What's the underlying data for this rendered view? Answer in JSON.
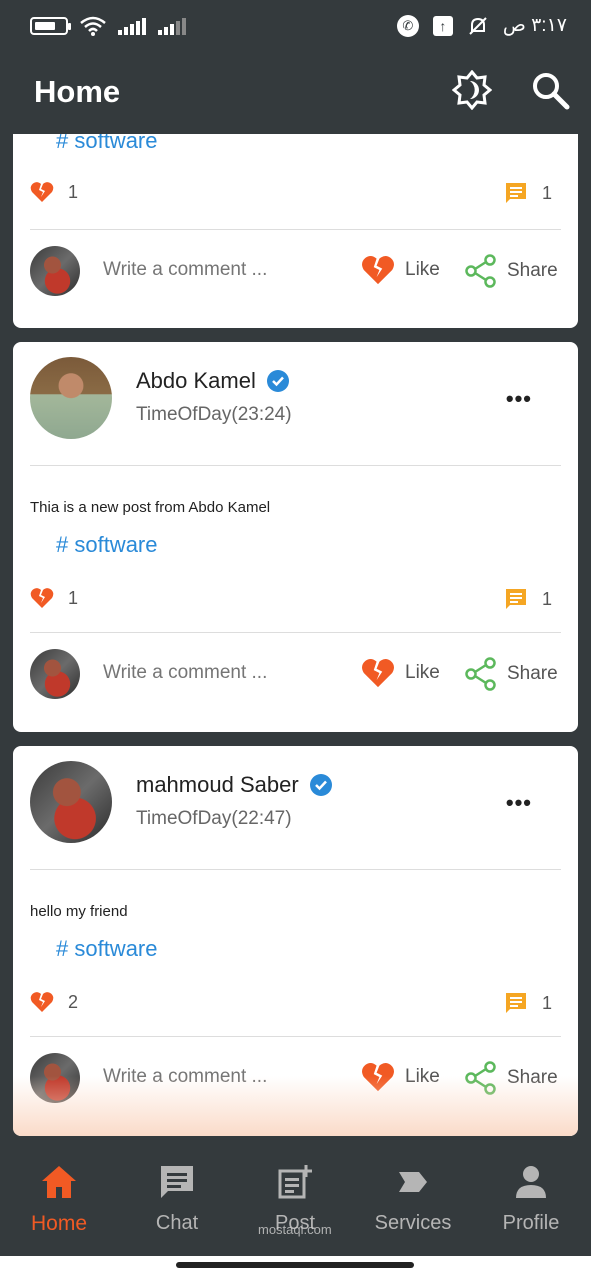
{
  "status_bar": {
    "time": "٣:١٧ ص",
    "icons": [
      "battery-icon",
      "wifi-icon",
      "signal-icon",
      "signal-icon",
      "phone-icon",
      "upload-icon",
      "mute-bell-icon"
    ]
  },
  "app_bar": {
    "title": "Home",
    "icons": [
      "brightness-icon",
      "search-icon"
    ]
  },
  "posts": [
    {
      "hashtag": "# software",
      "likes": "1",
      "comments": "1",
      "comment_placeholder": "Write a comment ...",
      "like_label": "Like",
      "share_label": "Share"
    },
    {
      "author": "Abdo Kamel",
      "time": "TimeOfDay(23:24)",
      "text": "Thia is a new post from Abdo Kamel",
      "hashtag": "# software",
      "likes": "1",
      "comments": "1",
      "comment_placeholder": "Write a comment ...",
      "like_label": "Like",
      "share_label": "Share"
    },
    {
      "author": "mahmoud Saber",
      "time": "TimeOfDay(22:47)",
      "text": "hello my friend",
      "hashtag": "# software",
      "likes": "2",
      "comments": "1",
      "comment_placeholder": "Write a comment ...",
      "like_label": "Like",
      "share_label": "Share"
    }
  ],
  "bottom_nav": {
    "items": [
      {
        "label": "Home",
        "icon": "home-icon",
        "active": true
      },
      {
        "label": "Chat",
        "icon": "chat-icon"
      },
      {
        "label": "Post",
        "icon": "post-add-icon"
      },
      {
        "label": "Services",
        "icon": "label-icon"
      },
      {
        "label": "Profile",
        "icon": "person-icon"
      }
    ]
  },
  "watermark": "mostaql.com",
  "colors": {
    "background": "#343a3d",
    "accent": "#f15a24",
    "hashtag": "#2a8ad8",
    "verified": "#2a8ad8",
    "comment_icon": "#f5a623",
    "share_icon": "#5cb85c"
  }
}
